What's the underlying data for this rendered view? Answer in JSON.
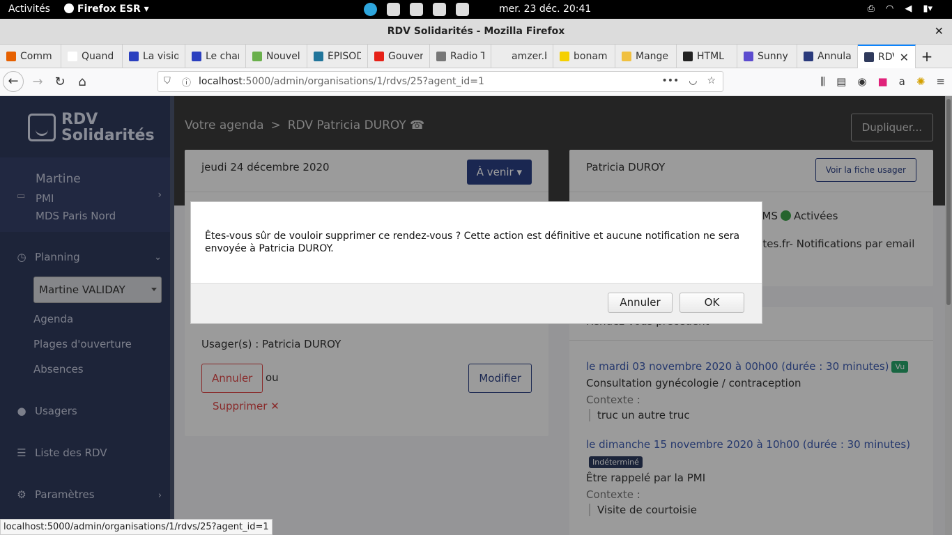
{
  "desktop": {
    "activities": "Activités",
    "app_menu": "Firefox ESR",
    "clock": "mer. 23 déc.  20:41"
  },
  "window": {
    "title": "RDV Solidarités - Mozilla Firefox"
  },
  "tabs": [
    {
      "label": "Comm",
      "color": "#e66000"
    },
    {
      "label": "Quand l'Ét",
      "color": "#ffffff"
    },
    {
      "label": "La visio",
      "color": "#2a3fbf"
    },
    {
      "label": "Le char",
      "color": "#2a3fbf"
    },
    {
      "label": "Nouvel",
      "color": "#6ab04c"
    },
    {
      "label": "ÉPISOD",
      "color": "#21759b"
    },
    {
      "label": "Gouver",
      "color": "#e62117"
    },
    {
      "label": "Radio T",
      "color": "#777777"
    },
    {
      "label": "amzer.bzh",
      "color": "#ececec"
    },
    {
      "label": "bonam",
      "color": "#f5d000"
    },
    {
      "label": "Mange",
      "color": "#f0c040"
    },
    {
      "label": "HTML",
      "color": "#222222"
    },
    {
      "label": "Sunny",
      "color": "#5c4ccf"
    },
    {
      "label": "Annula",
      "color": "#2a3a7c"
    },
    {
      "label": "RDV",
      "color": "#2f3a5c"
    }
  ],
  "urlbar": {
    "host": "localhost",
    "path": ":5000/admin/organisations/1/rdvs/25?agent_id=1"
  },
  "sidebar": {
    "brand_line1": "RDV",
    "brand_line2": "Solidarités",
    "user_name": "Martine",
    "user_role": "PMI",
    "user_org": "MDS Paris Nord",
    "planning": "Planning",
    "agent_selected": "Martine VALIDAY",
    "agenda": "Agenda",
    "plages": "Plages d'ouverture",
    "absences": "Absences",
    "usagers": "Usagers",
    "liste_rdv": "Liste des RDV",
    "parametres": "Paramètres"
  },
  "breadcrumb": {
    "root": "Votre agenda",
    "sep": ">",
    "current": "RDV Patricia DUROY ☎"
  },
  "header": {
    "duplicate": "Dupliquer..."
  },
  "rdv_card": {
    "date": "jeudi 24 décembre 2020",
    "status": "À venir",
    "usagers_label": "Usager(s) :",
    "usagers_value": "Patricia DUROY",
    "annuler": "Annuler",
    "ou": "ou",
    "modifier": "Modifier",
    "supprimer": "Supprimer"
  },
  "user_card": {
    "name": "Patricia DUROY",
    "view_button": "Voir la fiche usager",
    "sms_prefix": "SMS",
    "sms_state": "Activées",
    "email_line": "rites.fr- Notifications par email"
  },
  "previous_rdvs": {
    "title": "Rendez-vous précédent",
    "items": [
      {
        "when": "le mardi 03 novembre 2020 à 00h00 (durée : 30 minutes)",
        "badge": "Vu",
        "motif": "Consultation gynécologie / contraception",
        "context_label": "Contexte :",
        "context": "truc un autre truc"
      },
      {
        "when": "le dimanche 15 novembre 2020 à 10h00 (durée : 30 minutes)",
        "badge": "Indéterminé",
        "motif": "Être rappelé par la PMI",
        "context_label": "Contexte :",
        "context": "Visite de courtoisie"
      }
    ]
  },
  "dialog": {
    "message": "Êtes-vous sûr de vouloir supprimer ce rendez-vous ? Cette action est définitive et aucune notification ne sera envoyée à Patricia DUROY.",
    "cancel": "Annuler",
    "ok": "OK"
  },
  "status_url": "localhost:5000/admin/organisations/1/rdvs/25?agent_id=1"
}
